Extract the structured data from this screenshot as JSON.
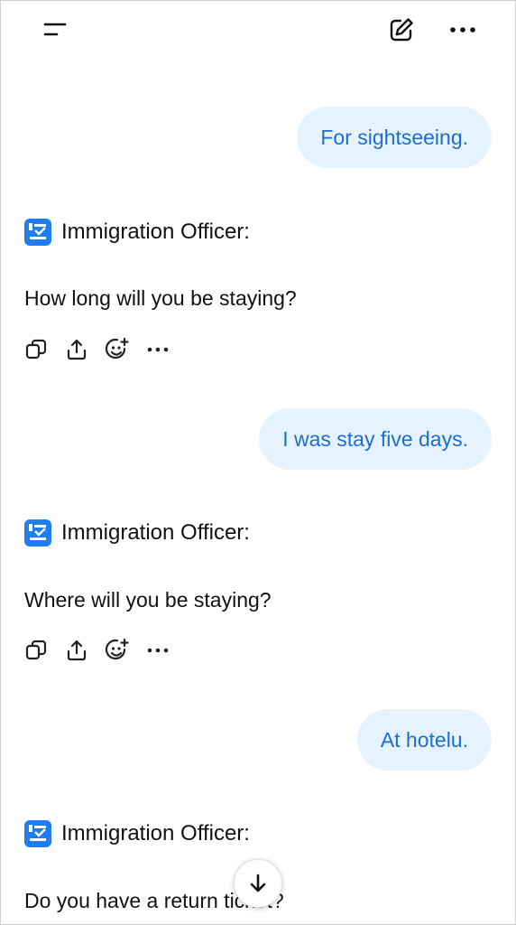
{
  "colors": {
    "user_bubble_bg": "#e6f2fd",
    "user_bubble_text": "#1b6fd1",
    "officer_badge": "#1e7ef0"
  },
  "header": {
    "icons": [
      "menu-icon",
      "compose-icon",
      "more-horizontal-icon"
    ]
  },
  "messages": [
    {
      "role": "user",
      "text": "For sightseeing."
    },
    {
      "role": "assistant",
      "speaker": "Immigration Officer:",
      "text": "How long will you be staying?"
    },
    {
      "role": "user",
      "text": "I was stay five days."
    },
    {
      "role": "assistant",
      "speaker": "Immigration Officer:",
      "text": "Where will you be staying?"
    },
    {
      "role": "user",
      "text": "At hotelu."
    },
    {
      "role": "assistant",
      "speaker": "Immigration Officer:",
      "text": "Do you have a return ticket?"
    }
  ],
  "message_actions": [
    "copy-icon",
    "share-icon",
    "add-reaction-icon",
    "more-horizontal-icon"
  ],
  "scroll_button_icon": "arrow-down-icon"
}
